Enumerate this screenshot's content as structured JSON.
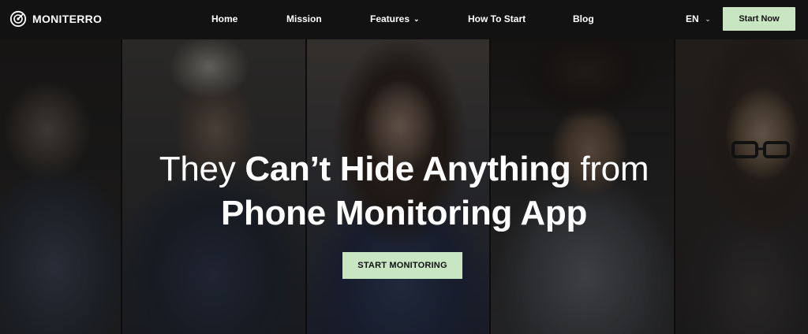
{
  "brand": {
    "name": "MONITERRO",
    "icon": "radar-logo-icon"
  },
  "nav": {
    "items": [
      {
        "label": "Home"
      },
      {
        "label": "Mission"
      },
      {
        "label": "Features",
        "has_dropdown": true
      },
      {
        "label": "How To Start"
      },
      {
        "label": "Blog"
      }
    ],
    "language": "EN",
    "cta_label": "Start Now"
  },
  "hero": {
    "line1_light_a": "They ",
    "line1_bold": "Can’t Hide Anything",
    "line1_light_b": " from",
    "line2": "Phone Monitoring App",
    "cta_label": "START MONITORING"
  },
  "colors": {
    "header_bg": "#121212",
    "accent_button": "#c9e6c3",
    "text": "#ffffff"
  }
}
